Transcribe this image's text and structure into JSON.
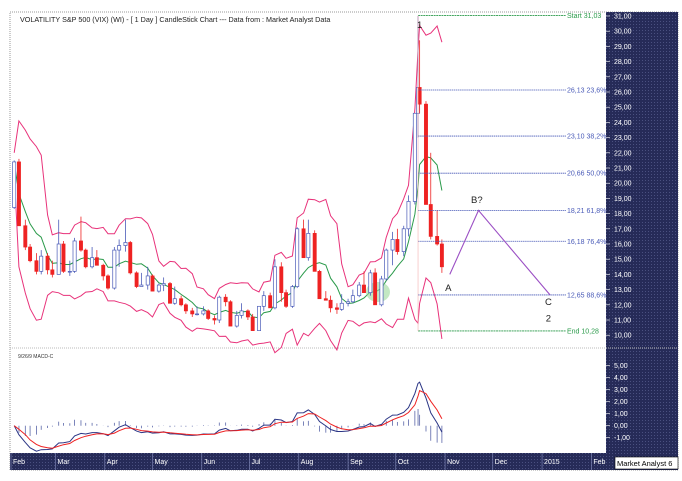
{
  "header": {
    "title": "VOLATILITY S&P 500 (VIX) (WI) -  [ 1 Day ] CandleStick Chart --- Data from : Market Analyst Data",
    "branding": "Market Analyst 6"
  },
  "colors": {
    "up_candle": "#4a5bb8",
    "down_candle": "#ee2222",
    "moving_average": "#2a9a4a",
    "bollinger": "#e8327a",
    "fib_line": "#4a5bb8",
    "fib_end_line": "#2a9a4a",
    "projection": "#9b4fc4",
    "axis_panel": "#262b58",
    "macd_line": "#2b3585",
    "signal_line": "#ee2222",
    "histogram": "#5a66a8"
  },
  "chart_data": [
    {
      "type": "candlestick",
      "title": "VOLATILITY S&P 500 (VIX) (WI) -  [ 1 Day ] CandleStick Chart --- Data from : Market Analyst Data",
      "ylim": [
        9.5,
        31.2
      ],
      "xlim": [
        "2014-02-01",
        "2015-02-28"
      ],
      "y_ticks": [
        "31,00",
        "30,00",
        "29,00",
        "28,00",
        "27,00",
        "26,00",
        "25,00",
        "24,00",
        "23,00",
        "22,00",
        "21,00",
        "20,00",
        "19,00",
        "18,00",
        "17,00",
        "16,00",
        "15,00",
        "14,00",
        "13,00",
        "12,00",
        "11,00",
        "10,00"
      ],
      "x_ticks": [
        {
          "label": "Feb",
          "date": "2014-02-01"
        },
        {
          "label": "Mar",
          "date": "2014-03-01"
        },
        {
          "label": "Apr",
          "date": "2014-04-01"
        },
        {
          "label": "May",
          "date": "2014-05-01"
        },
        {
          "label": "Jun",
          "date": "2014-06-01"
        },
        {
          "label": "Jul",
          "date": "2014-07-01"
        },
        {
          "label": "Aug",
          "date": "2014-08-01"
        },
        {
          "label": "Sep",
          "date": "2014-09-01"
        },
        {
          "label": "Oct",
          "date": "2014-10-01"
        },
        {
          "label": "Nov",
          "date": "2014-11-01"
        },
        {
          "label": "Dec",
          "date": "2014-12-01"
        },
        {
          "label": "2015",
          "date": "2015-01-01"
        },
        {
          "label": "Feb",
          "date": "2015-02-01"
        }
      ],
      "overlays": [
        "20-day moving average",
        "Bollinger bands"
      ],
      "candles": [
        [
          "2014-02-03",
          18.4,
          21.5,
          18.3,
          21.4
        ],
        [
          "2014-02-06",
          21.4,
          21.6,
          17.2,
          17.2
        ],
        [
          "2014-02-10",
          17.2,
          17.6,
          15.6,
          15.8
        ],
        [
          "2014-02-13",
          15.8,
          16.0,
          14.8,
          14.9
        ],
        [
          "2014-02-17",
          14.9,
          15.4,
          14.0,
          14.2
        ],
        [
          "2014-02-20",
          14.2,
          15.6,
          14.0,
          15.2
        ],
        [
          "2014-02-24",
          15.2,
          15.4,
          14.0,
          14.3
        ],
        [
          "2014-02-27",
          14.3,
          14.9,
          13.8,
          14.0
        ],
        [
          "2014-03-03",
          14.0,
          17.6,
          14.0,
          16.0
        ],
        [
          "2014-03-06",
          16.0,
          16.2,
          14.1,
          14.2
        ],
        [
          "2014-03-10",
          14.2,
          14.9,
          13.9,
          14.2
        ],
        [
          "2014-03-13",
          14.2,
          16.4,
          14.1,
          16.2
        ],
        [
          "2014-03-17",
          16.2,
          17.8,
          15.5,
          15.6
        ],
        [
          "2014-03-20",
          15.6,
          15.7,
          14.4,
          14.5
        ],
        [
          "2014-03-24",
          14.5,
          15.8,
          14.4,
          15.1
        ],
        [
          "2014-03-27",
          15.1,
          15.6,
          14.6,
          14.6
        ],
        [
          "2014-03-31",
          14.6,
          14.7,
          13.6,
          13.9
        ],
        [
          "2014-04-03",
          13.9,
          14.0,
          13.0,
          13.1
        ],
        [
          "2014-04-07",
          13.1,
          15.8,
          13.0,
          15.6
        ],
        [
          "2014-04-10",
          15.6,
          16.3,
          14.5,
          15.9
        ],
        [
          "2014-04-14",
          15.9,
          17.6,
          15.5,
          16.1
        ],
        [
          "2014-04-17",
          16.1,
          16.2,
          14.0,
          14.1
        ],
        [
          "2014-04-21",
          14.1,
          14.2,
          13.1,
          13.2
        ],
        [
          "2014-04-24",
          13.2,
          14.1,
          13.2,
          13.3
        ],
        [
          "2014-04-28",
          13.3,
          14.5,
          13.0,
          13.9
        ],
        [
          "2014-05-01",
          13.9,
          14.0,
          12.9,
          12.9
        ],
        [
          "2014-05-05",
          12.9,
          13.4,
          12.8,
          13.3
        ],
        [
          "2014-05-08",
          13.3,
          13.8,
          12.9,
          13.4
        ],
        [
          "2014-05-12",
          13.4,
          13.5,
          12.1,
          12.1
        ],
        [
          "2014-05-15",
          12.1,
          13.2,
          12.0,
          12.4
        ],
        [
          "2014-05-19",
          12.4,
          12.6,
          11.9,
          12.0
        ],
        [
          "2014-05-22",
          12.0,
          12.1,
          11.4,
          11.6
        ],
        [
          "2014-05-26",
          11.6,
          11.8,
          11.2,
          11.4
        ],
        [
          "2014-05-29",
          11.4,
          11.9,
          11.3,
          11.4
        ],
        [
          "2014-06-02",
          11.4,
          11.9,
          11.3,
          11.6
        ],
        [
          "2014-06-05",
          11.6,
          11.7,
          11.0,
          11.1
        ],
        [
          "2014-06-09",
          11.1,
          11.3,
          10.7,
          11.0
        ],
        [
          "2014-06-12",
          11.0,
          12.6,
          10.8,
          12.5
        ],
        [
          "2014-06-16",
          12.5,
          12.7,
          11.9,
          12.2
        ],
        [
          "2014-06-19",
          12.2,
          12.3,
          10.6,
          10.6
        ],
        [
          "2014-06-23",
          10.6,
          11.6,
          10.5,
          11.3
        ],
        [
          "2014-06-26",
          11.3,
          12.1,
          11.1,
          11.6
        ],
        [
          "2014-06-30",
          11.6,
          11.7,
          11.0,
          11.2
        ],
        [
          "2014-07-03",
          11.2,
          11.4,
          10.3,
          10.3
        ],
        [
          "2014-07-07",
          10.3,
          11.9,
          10.3,
          11.9
        ],
        [
          "2014-07-10",
          11.9,
          12.9,
          11.6,
          12.6
        ],
        [
          "2014-07-14",
          12.6,
          12.8,
          11.8,
          11.8
        ],
        [
          "2014-07-17",
          11.8,
          15.0,
          11.7,
          14.5
        ],
        [
          "2014-07-21",
          14.5,
          14.8,
          12.2,
          12.8
        ],
        [
          "2014-07-24",
          12.8,
          13.0,
          11.8,
          11.9
        ],
        [
          "2014-07-28",
          11.9,
          13.3,
          11.8,
          13.2
        ],
        [
          "2014-07-31",
          13.2,
          17.1,
          13.1,
          17.0
        ],
        [
          "2014-08-04",
          17.0,
          17.6,
          15.1,
          15.1
        ],
        [
          "2014-08-07",
          15.1,
          17.6,
          14.9,
          16.7
        ],
        [
          "2014-08-11",
          16.7,
          16.9,
          14.2,
          14.2
        ],
        [
          "2014-08-14",
          14.2,
          14.3,
          12.4,
          12.4
        ],
        [
          "2014-08-18",
          12.4,
          12.9,
          12.3,
          12.3
        ],
        [
          "2014-08-21",
          12.3,
          12.6,
          11.5,
          11.8
        ],
        [
          "2014-08-25",
          11.8,
          12.1,
          11.4,
          11.7
        ],
        [
          "2014-08-28",
          11.7,
          12.7,
          11.6,
          12.1
        ],
        [
          "2014-09-01",
          12.1,
          12.4,
          11.9,
          12.2
        ],
        [
          "2014-09-04",
          12.2,
          13.0,
          12.1,
          12.6
        ],
        [
          "2014-09-08",
          12.6,
          13.5,
          12.5,
          13.3
        ],
        [
          "2014-09-11",
          13.3,
          14.2,
          12.8,
          12.8
        ],
        [
          "2014-09-15",
          12.8,
          14.3,
          12.6,
          14.1
        ],
        [
          "2014-09-18",
          14.1,
          14.4,
          12.0,
          12.0
        ],
        [
          "2014-09-22",
          12.0,
          13.9,
          11.9,
          13.7
        ],
        [
          "2014-09-25",
          13.7,
          15.7,
          13.6,
          15.6
        ],
        [
          "2014-09-29",
          15.6,
          16.8,
          14.6,
          16.3
        ],
        [
          "2014-10-02",
          16.3,
          17.0,
          15.3,
          15.5
        ],
        [
          "2014-10-06",
          15.5,
          17.2,
          15.2,
          17.0
        ],
        [
          "2014-10-09",
          17.0,
          19.2,
          16.5,
          18.8
        ],
        [
          "2014-10-13",
          18.8,
          24.6,
          18.6,
          24.6
        ],
        [
          "2014-10-15",
          24.6,
          31.0,
          23.0,
          26.3
        ],
        [
          "2014-10-16",
          26.3,
          29.4,
          24.6,
          25.2
        ],
        [
          "2014-10-20",
          25.2,
          25.4,
          18.6,
          18.6
        ],
        [
          "2014-10-23",
          18.6,
          22.0,
          16.3,
          16.5
        ],
        [
          "2014-10-27",
          16.5,
          18.2,
          15.9,
          16.0
        ],
        [
          "2014-10-30",
          16.0,
          16.3,
          14.1,
          14.5
        ]
      ],
      "fibonacci_levels": [
        {
          "label": "Start 31,03",
          "price": 31.03,
          "kind": "end"
        },
        {
          "label": "26,13 23,6%",
          "price": 26.13,
          "kind": "fib"
        },
        {
          "label": "23,10 38,2%",
          "price": 23.1,
          "kind": "fib"
        },
        {
          "label": "20,66 50,0%",
          "price": 20.66,
          "kind": "fib"
        },
        {
          "label": "18,21 61,8%",
          "price": 18.21,
          "kind": "fib"
        },
        {
          "label": "16,18 76,4%",
          "price": 16.18,
          "kind": "fib"
        },
        {
          "label": "12,65 88,6%",
          "price": 12.65,
          "kind": "fib"
        },
        {
          "label": "End 10,28",
          "price": 10.28,
          "kind": "end"
        }
      ],
      "fib_start_date": "2014-10-15",
      "wave_labels": [
        {
          "label": "1",
          "date": "2014-10-16",
          "price": 30.2
        },
        {
          "label": "A",
          "date": "2014-11-03",
          "price": 12.9
        },
        {
          "label": "B?",
          "date": "2014-11-21",
          "price": 18.7
        },
        {
          "label": "C",
          "date": "2015-01-05",
          "price": 12.0
        },
        {
          "label": "2",
          "date": "2015-01-05",
          "price": 10.9
        }
      ],
      "projection_path": [
        {
          "date": "2014-11-04",
          "price": 14.0
        },
        {
          "date": "2014-11-22",
          "price": 18.21
        },
        {
          "date": "2015-01-06",
          "price": 12.65
        }
      ]
    },
    {
      "type": "line",
      "title": "9/26/9 MACD-C",
      "ylim": [
        -2.3,
        6.8
      ],
      "y_ticks": [
        "5,00",
        "4,00",
        "3,00",
        "2,00",
        "1,00",
        "0,00",
        "-1,00"
      ],
      "series": [
        "MACD",
        "Signal",
        "Histogram"
      ]
    }
  ]
}
